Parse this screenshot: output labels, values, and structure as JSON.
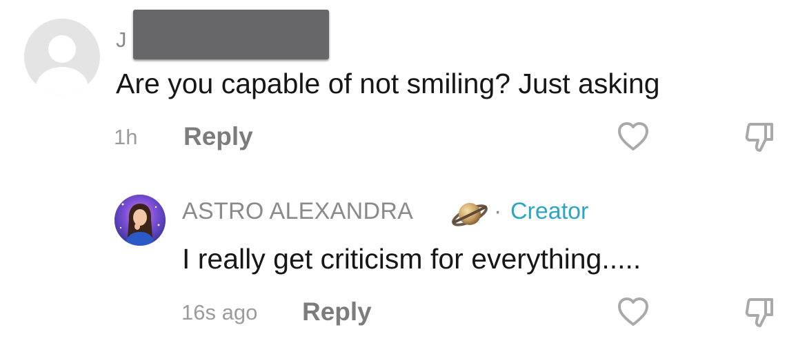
{
  "comment": {
    "username_visible": "J",
    "text": "Are you capable of not smiling? Just asking",
    "time": "1h",
    "reply_label": "Reply"
  },
  "reply": {
    "author": "ASTRO ALEXANDRA",
    "badge_separator": "·",
    "badge": "Creator",
    "text": "I really get criticism for everything.....",
    "time": "16s ago",
    "reply_label": "Reply"
  },
  "icons": {
    "like": "heart-outline-icon",
    "dislike": "thumbs-down-outline-icon",
    "planet_emoji": "ringed-planet-icon"
  },
  "colors": {
    "text_primary": "#161616",
    "text_secondary": "#8a8a8a",
    "creator_accent": "#2ba6c8",
    "redaction": "#67676a"
  }
}
